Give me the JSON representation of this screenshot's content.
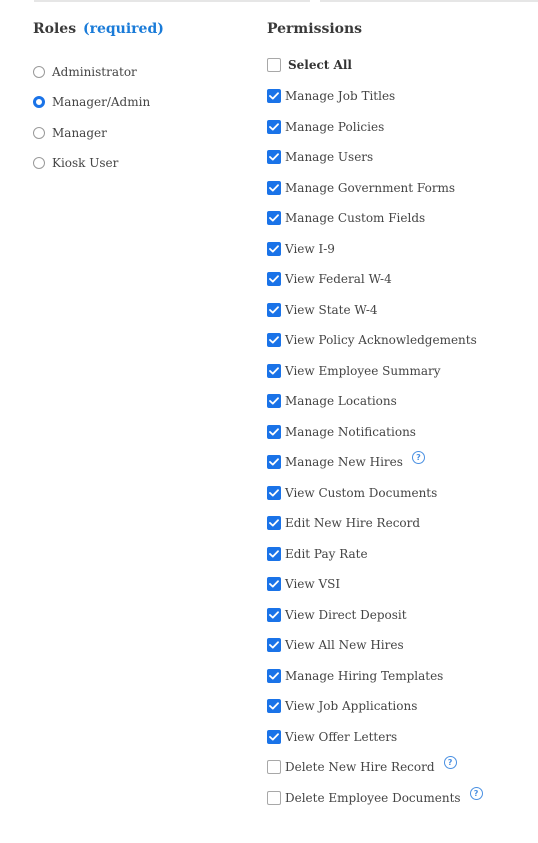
{
  "roles": {
    "heading": "Roles",
    "required_label": "(required)",
    "selected": "Manager/Admin",
    "items": [
      {
        "label": "Administrator",
        "checked": false
      },
      {
        "label": "Manager/Admin",
        "checked": true
      },
      {
        "label": "Manager",
        "checked": false
      },
      {
        "label": "Kiosk User",
        "checked": false
      }
    ]
  },
  "permissions": {
    "heading": "Permissions",
    "select_all_label": "Select All",
    "select_all_checked": false,
    "help_icon": "question-circle-icon",
    "items": [
      {
        "label": "Manage Job Titles",
        "checked": true,
        "help": false
      },
      {
        "label": "Manage Policies",
        "checked": true,
        "help": false
      },
      {
        "label": "Manage Users",
        "checked": true,
        "help": false
      },
      {
        "label": "Manage Government Forms",
        "checked": true,
        "help": false
      },
      {
        "label": "Manage Custom Fields",
        "checked": true,
        "help": false
      },
      {
        "label": "View I-9",
        "checked": true,
        "help": false
      },
      {
        "label": "View Federal W-4",
        "checked": true,
        "help": false
      },
      {
        "label": "View State W-4",
        "checked": true,
        "help": false
      },
      {
        "label": "View Policy Acknowledgements",
        "checked": true,
        "help": false
      },
      {
        "label": "View Employee Summary",
        "checked": true,
        "help": false
      },
      {
        "label": "Manage Locations",
        "checked": true,
        "help": false
      },
      {
        "label": "Manage Notifications",
        "checked": true,
        "help": false
      },
      {
        "label": "Manage New Hires",
        "checked": true,
        "help": true
      },
      {
        "label": "View Custom Documents",
        "checked": true,
        "help": false
      },
      {
        "label": "Edit New Hire Record",
        "checked": true,
        "help": false
      },
      {
        "label": "Edit Pay Rate",
        "checked": true,
        "help": false
      },
      {
        "label": "View VSI",
        "checked": true,
        "help": false
      },
      {
        "label": "View Direct Deposit",
        "checked": true,
        "help": false
      },
      {
        "label": "View All New Hires",
        "checked": true,
        "help": false
      },
      {
        "label": "Manage Hiring Templates",
        "checked": true,
        "help": false
      },
      {
        "label": "View Job Applications",
        "checked": true,
        "help": false
      },
      {
        "label": "View Offer Letters",
        "checked": true,
        "help": false
      },
      {
        "label": "Delete New Hire Record",
        "checked": false,
        "help": true
      },
      {
        "label": "Delete Employee Documents",
        "checked": false,
        "help": true
      }
    ]
  },
  "colors": {
    "accent": "#1a73e8",
    "required": "#1a7bd8",
    "help": "#4a90e2",
    "text": "#444444"
  }
}
